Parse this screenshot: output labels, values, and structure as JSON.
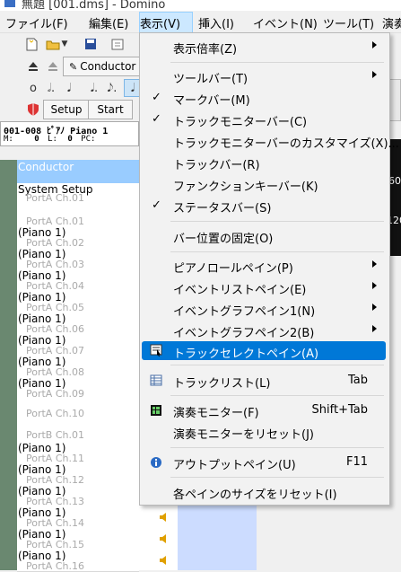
{
  "window": {
    "title": "無題 [001.dms] - Domino"
  },
  "menubar": [
    "ファイル(F)",
    "編集(E)",
    "表示(V)",
    "挿入(I)",
    "イベント(N)",
    "ツール(T)",
    "演奏"
  ],
  "toolbar": {
    "conductor_label": "Conductor",
    "setup_label": "Setup",
    "start_label": "Start",
    "notes": [
      "𝅘𝅥",
      "𝅗𝅥.",
      "𝅘𝅥",
      "𝅘𝅥.",
      "𝅘𝅥𝅮.",
      "𝅘𝅥"
    ]
  },
  "trackbar": {
    "track_text": "001-008 ﾋﾟｱﾉ Piano 1",
    "m_label": "M:",
    "m_value": "0",
    "l_label": "L:",
    "l_value": "0",
    "pc_label": "PC:"
  },
  "tracks": [
    {
      "name": "Conductor",
      "port": ""
    },
    {
      "name": "System Setup",
      "port": "PortA  Ch.01"
    },
    {
      "name": "",
      "port": "PortA  Ch.01"
    },
    {
      "name": "(Piano 1)",
      "port": "PortA  Ch.02"
    },
    {
      "name": "(Piano 1)",
      "port": "PortA  Ch.03"
    },
    {
      "name": "(Piano 1)",
      "port": "PortA  Ch.04"
    },
    {
      "name": "(Piano 1)",
      "port": "PortA  Ch.05"
    },
    {
      "name": "(Piano 1)",
      "port": "PortA  Ch.06"
    },
    {
      "name": "(Piano 1)",
      "port": "PortA  Ch.07"
    },
    {
      "name": "(Piano 1)",
      "port": "PortA  Ch.08"
    },
    {
      "name": "(Piano 1)",
      "port": "PortA  Ch.09"
    },
    {
      "name": "",
      "port": "PortA  Ch.10"
    },
    {
      "name": "",
      "port": "PortB  Ch.01"
    },
    {
      "name": "(Piano 1)",
      "port": "PortA  Ch.11"
    },
    {
      "name": "(Piano 1)",
      "port": "PortA  Ch.12"
    },
    {
      "name": "(Piano 1)",
      "port": "PortA  Ch.13"
    },
    {
      "name": "(Piano 1)",
      "port": "PortA  Ch.14"
    },
    {
      "name": "(Piano 1)",
      "port": "PortA  Ch.15"
    },
    {
      "name": "(Piano 1)",
      "port": "PortA  Ch.16"
    }
  ],
  "right_panel": {
    "values": [
      "60",
      "120"
    ]
  },
  "view_menu": [
    {
      "type": "item",
      "label": "表示倍率(Z)",
      "submenu": true
    },
    {
      "type": "sep"
    },
    {
      "type": "item",
      "label": "ツールバー(T)",
      "submenu": true
    },
    {
      "type": "item",
      "label": "マークバー(M)",
      "checked": true
    },
    {
      "type": "item",
      "label": "トラックモニターバー(C)",
      "checked": true
    },
    {
      "type": "item",
      "label": "トラックモニターバーのカスタマイズ(X)..."
    },
    {
      "type": "item",
      "label": "トラックバー(R)"
    },
    {
      "type": "item",
      "label": "ファンクションキーバー(K)"
    },
    {
      "type": "item",
      "label": "ステータスバー(S)",
      "checked": true
    },
    {
      "type": "sep"
    },
    {
      "type": "item",
      "label": "バー位置の固定(O)"
    },
    {
      "type": "sep"
    },
    {
      "type": "item",
      "label": "ピアノロールペイン(P)",
      "submenu": true
    },
    {
      "type": "item",
      "label": "イベントリストペイン(E)",
      "submenu": true
    },
    {
      "type": "item",
      "label": "イベントグラフペイン1(N)",
      "submenu": true
    },
    {
      "type": "item",
      "label": "イベントグラフペイン2(B)",
      "submenu": true
    },
    {
      "type": "item",
      "label": "トラックセレクトペイン(A)",
      "highlighted": true,
      "icon": "track-select-icon"
    },
    {
      "type": "sep"
    },
    {
      "type": "item",
      "label": "トラックリスト(L)",
      "shortcut": "Tab",
      "icon": "track-list-icon"
    },
    {
      "type": "sep"
    },
    {
      "type": "item",
      "label": "演奏モニター(F)",
      "shortcut": "Shift+Tab",
      "icon": "play-monitor-icon"
    },
    {
      "type": "item",
      "label": "演奏モニターをリセット(J)"
    },
    {
      "type": "sep"
    },
    {
      "type": "item",
      "label": "アウトプットペイン(U)",
      "shortcut": "F11",
      "icon": "info-icon"
    },
    {
      "type": "sep"
    },
    {
      "type": "item",
      "label": "各ペインのサイズをリセット(I)"
    }
  ],
  "colors": {
    "highlight": "#0078d7",
    "selected_track": "#99ccff",
    "track_panel_blue": "#ccdcff"
  }
}
